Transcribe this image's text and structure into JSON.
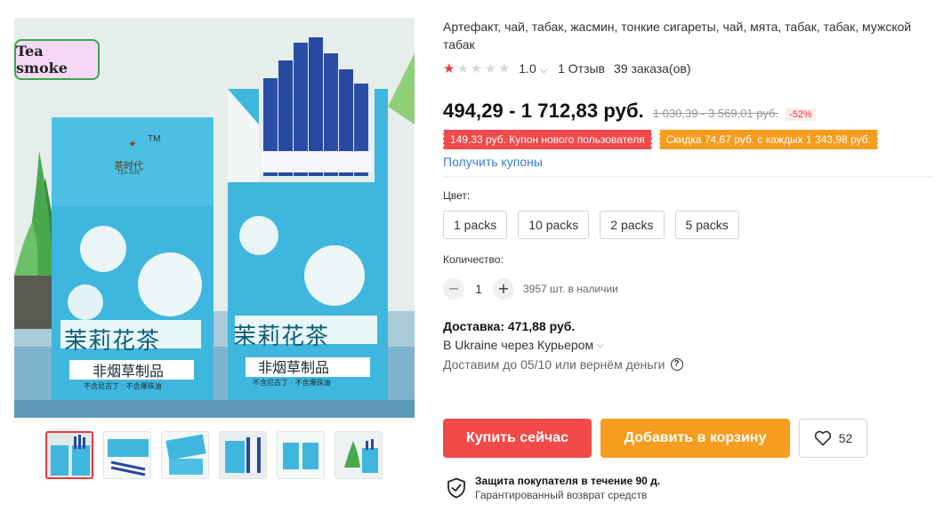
{
  "gallery": {
    "watermark_text": "Tea smoke",
    "box_brand_cn": "茶时代",
    "box_brand_sub": "TEA AGE",
    "box_tm": "TM",
    "box_title_cn": "茉莉花茶",
    "box_subtitle_cn": "非烟草制品",
    "box_note_cn": "不含尼古丁 · 不含爆珠油",
    "thumbnail_count": 6,
    "active_thumbnail": 0
  },
  "product": {
    "title": "Артефакт, чай, табак, жасмин, тонкие сигареты, чай, мята, табак, табак, мужской табак",
    "rating": {
      "stars_filled": 1,
      "stars_total": 5,
      "value": "1.0",
      "reviews": "1 Отзыв",
      "orders": "39 заказа(ов)"
    },
    "price": {
      "current": "494,29 - 1 712,83 руб.",
      "old": "1 030,39 - 3 569,01 руб.",
      "discount": "-52%"
    },
    "coupons": [
      "149,33 руб. Купон нового пользователя",
      "Скидка 74,67 руб. с каждых 1 343,98 руб."
    ],
    "get_coupons": "Получить купоны",
    "color_label": "Цвет:",
    "options": [
      "1 packs",
      "10 packs",
      "2 packs",
      "5 packs"
    ],
    "quantity_label": "Количество:",
    "quantity": "1",
    "stock": "3957 шт. в наличии",
    "delivery": {
      "title": "Доставка: 471,88 руб.",
      "route": "В Ukraine через Курьером",
      "promise": "Доставим до 05/10 или вернём деньги"
    },
    "actions": {
      "buy": "Купить сейчас",
      "cart": "Добавить в корзину",
      "wishlist_count": "52"
    },
    "protection": {
      "title": "Защита покупателя в течение 90 д.",
      "subtitle": "Гарантированный возврат средств"
    }
  },
  "colors": {
    "accent_red": "#f04a4a",
    "accent_orange": "#f59d1f",
    "link_blue": "#3a7bd5",
    "box_cyan": "#3fb6dd"
  }
}
